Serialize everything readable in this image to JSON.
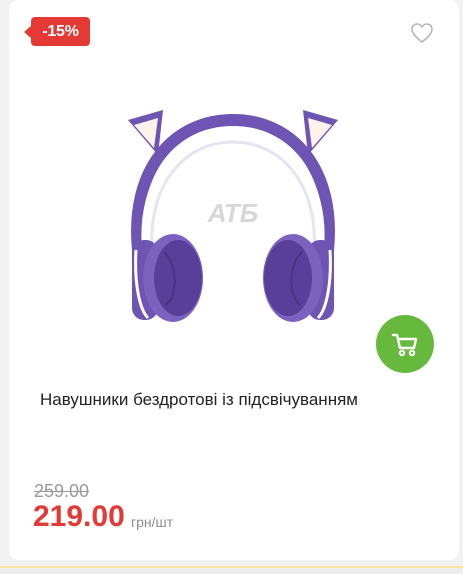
{
  "product": {
    "discount_badge": "-15%",
    "title": "Навушники бездротові із підсвічуванням",
    "old_price": "259.00",
    "price": "219.00",
    "unit": "грн/шт",
    "watermark": "АТБ"
  },
  "icons": {
    "wishlist": "heart-icon",
    "cart": "cart-icon"
  },
  "colors": {
    "discount": "#e53935",
    "cart_button": "#67b93e",
    "price": "#e53935"
  }
}
